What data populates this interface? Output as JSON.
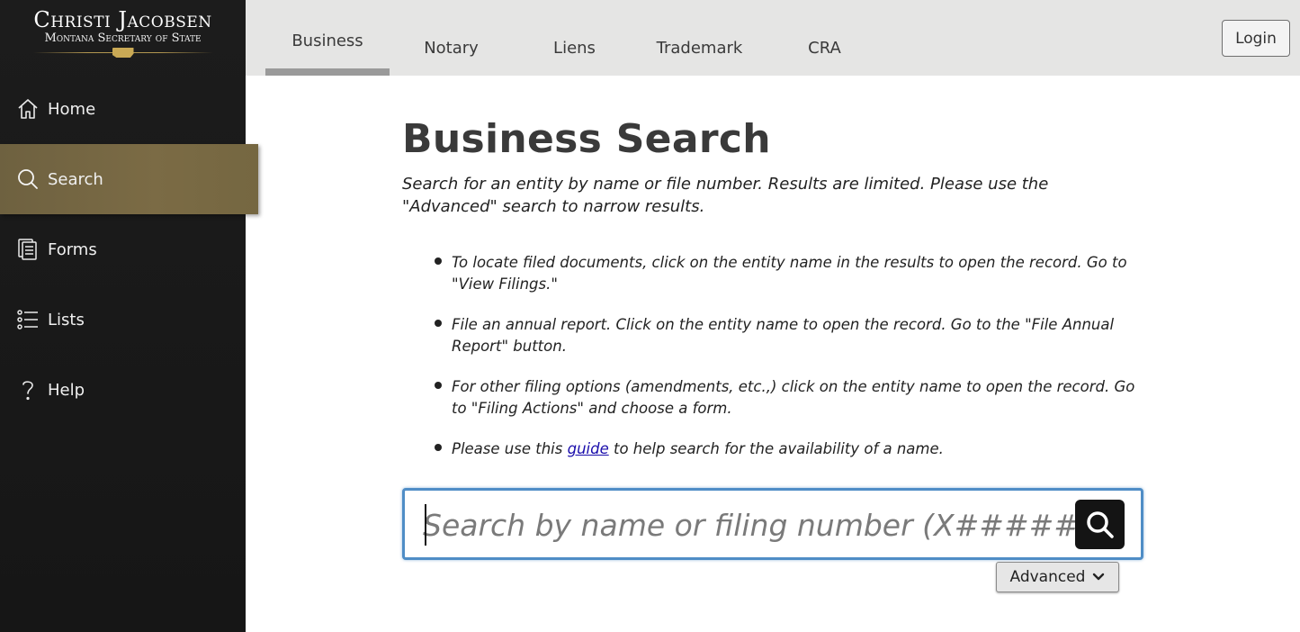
{
  "brand": {
    "official_name": "Christi Jacobsen",
    "office": "Montana Secretary of State"
  },
  "sidebar": {
    "items": [
      {
        "label": "Home",
        "icon": "home-icon",
        "active": false
      },
      {
        "label": "Search",
        "icon": "search-icon",
        "active": true
      },
      {
        "label": "Forms",
        "icon": "forms-icon",
        "active": false
      },
      {
        "label": "Lists",
        "icon": "list-icon",
        "active": false
      },
      {
        "label": "Help",
        "icon": "help-icon",
        "active": false
      }
    ]
  },
  "header": {
    "tabs": [
      {
        "label": "Business",
        "active": true
      },
      {
        "label": "Notary",
        "active": false
      },
      {
        "label": "Liens",
        "active": false
      },
      {
        "label": "Trademark",
        "active": false
      },
      {
        "label": "CRA",
        "active": false
      }
    ],
    "login_label": "Login"
  },
  "main": {
    "title": "Business Search",
    "description": "Search for an entity by name or file number. Results are limited. Please use the \"Advanced\" search to narrow results.",
    "bullets": [
      "To locate filed documents, click on the entity name in the results to open the record. Go to \"View Filings.\"",
      "File an annual report. Click on the entity name to open the record. Go to the \"File Annual Report\" button.",
      "For other filing options (amendments, etc.,) click on the entity name to open the record. Go to \"Filing Actions\" and choose a form."
    ],
    "guide_bullet": {
      "before": "Please use this ",
      "link": "guide",
      "after": " to help search for the availability of a name."
    },
    "search": {
      "value": "",
      "placeholder": "Search by name or filing number (X########)"
    },
    "advanced_label": "Advanced"
  },
  "colors": {
    "sidebar_bg": "#1c1c1c",
    "active_nav": "#756741",
    "topbar_bg": "#e5e5e4",
    "search_border": "#4f8dc6",
    "link": "#1a0dab"
  }
}
